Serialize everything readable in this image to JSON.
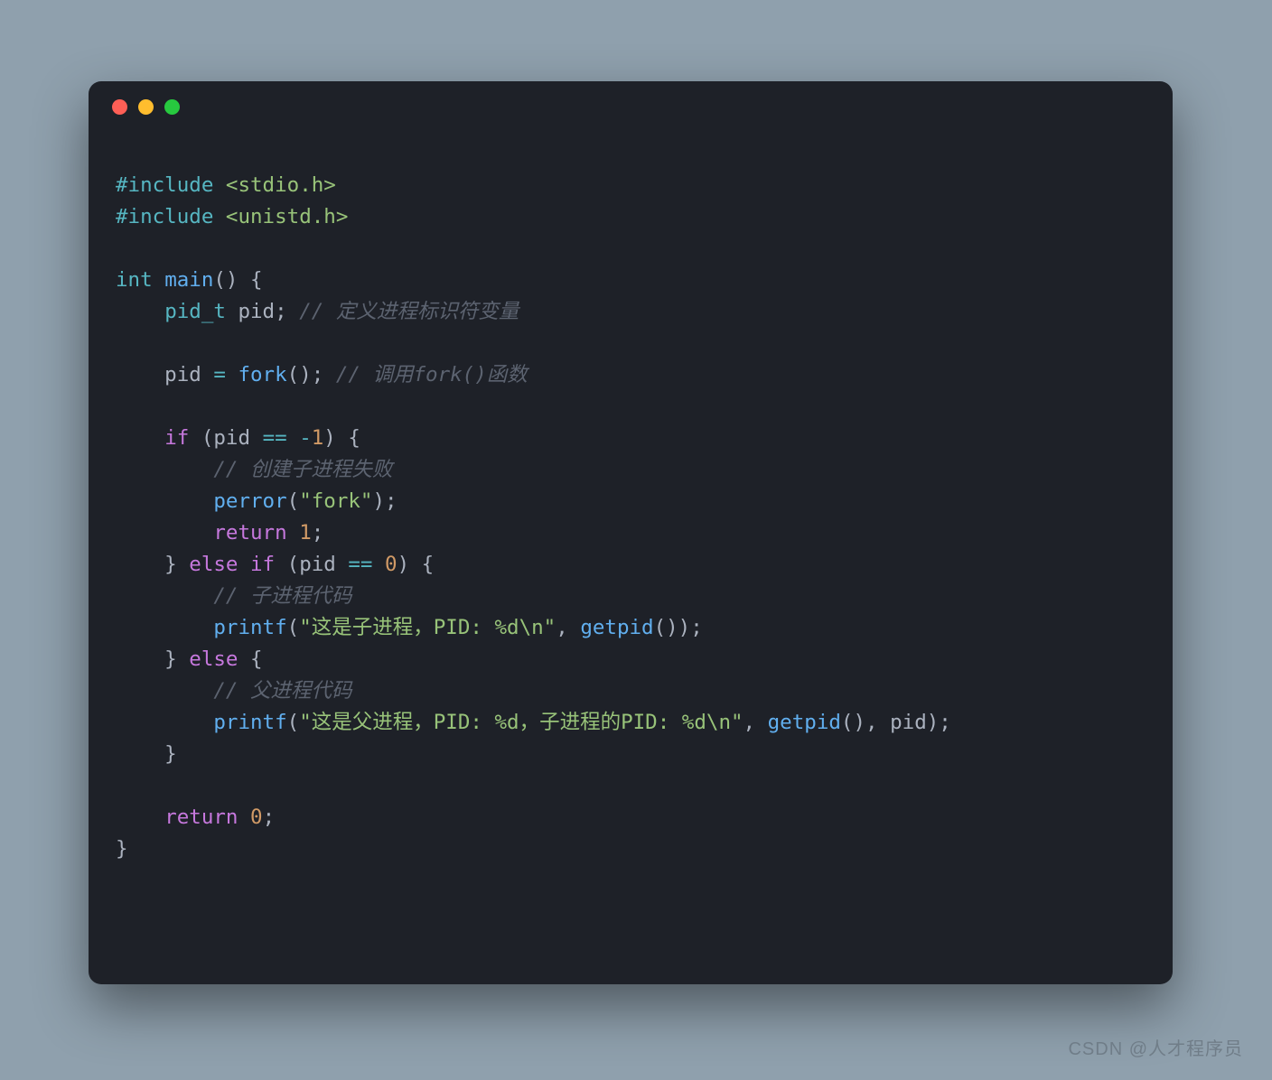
{
  "colors": {
    "background": "#8fa0ad",
    "window_bg": "#1e2128",
    "traffic_red": "#ff5f56",
    "traffic_yellow": "#ffbd2e",
    "traffic_green": "#27c93f"
  },
  "watermark": "CSDN @人才程序员",
  "code_lines": [
    [
      {
        "t": "#include",
        "c": "pre"
      },
      {
        "t": " ",
        "c": "punc"
      },
      {
        "t": "<stdio.h>",
        "c": "str"
      }
    ],
    [
      {
        "t": "#include",
        "c": "pre"
      },
      {
        "t": " ",
        "c": "punc"
      },
      {
        "t": "<unistd.h>",
        "c": "str"
      }
    ],
    [],
    [
      {
        "t": "int",
        "c": "type"
      },
      {
        "t": " ",
        "c": "punc"
      },
      {
        "t": "main",
        "c": "fn"
      },
      {
        "t": "() {",
        "c": "punc"
      }
    ],
    [
      {
        "t": "    ",
        "c": "punc"
      },
      {
        "t": "pid_t",
        "c": "type"
      },
      {
        "t": " pid; ",
        "c": "var"
      },
      {
        "t": "// 定义进程标识符变量",
        "c": "com"
      }
    ],
    [],
    [
      {
        "t": "    pid ",
        "c": "var"
      },
      {
        "t": "=",
        "c": "op"
      },
      {
        "t": " ",
        "c": "punc"
      },
      {
        "t": "fork",
        "c": "fn"
      },
      {
        "t": "(); ",
        "c": "punc"
      },
      {
        "t": "// 调用fork()函数",
        "c": "com"
      }
    ],
    [],
    [
      {
        "t": "    ",
        "c": "punc"
      },
      {
        "t": "if",
        "c": "key"
      },
      {
        "t": " (pid ",
        "c": "var"
      },
      {
        "t": "==",
        "c": "op"
      },
      {
        "t": " ",
        "c": "punc"
      },
      {
        "t": "-",
        "c": "op"
      },
      {
        "t": "1",
        "c": "num"
      },
      {
        "t": ") {",
        "c": "punc"
      }
    ],
    [
      {
        "t": "        ",
        "c": "punc"
      },
      {
        "t": "// 创建子进程失败",
        "c": "com"
      }
    ],
    [
      {
        "t": "        ",
        "c": "punc"
      },
      {
        "t": "perror",
        "c": "fn"
      },
      {
        "t": "(",
        "c": "punc"
      },
      {
        "t": "\"fork\"",
        "c": "str"
      },
      {
        "t": ");",
        "c": "punc"
      }
    ],
    [
      {
        "t": "        ",
        "c": "punc"
      },
      {
        "t": "return",
        "c": "key"
      },
      {
        "t": " ",
        "c": "punc"
      },
      {
        "t": "1",
        "c": "num"
      },
      {
        "t": ";",
        "c": "punc"
      }
    ],
    [
      {
        "t": "    } ",
        "c": "punc"
      },
      {
        "t": "else",
        "c": "key"
      },
      {
        "t": " ",
        "c": "punc"
      },
      {
        "t": "if",
        "c": "key"
      },
      {
        "t": " (pid ",
        "c": "var"
      },
      {
        "t": "==",
        "c": "op"
      },
      {
        "t": " ",
        "c": "punc"
      },
      {
        "t": "0",
        "c": "num"
      },
      {
        "t": ") {",
        "c": "punc"
      }
    ],
    [
      {
        "t": "        ",
        "c": "punc"
      },
      {
        "t": "// 子进程代码",
        "c": "com"
      }
    ],
    [
      {
        "t": "        ",
        "c": "punc"
      },
      {
        "t": "printf",
        "c": "fn"
      },
      {
        "t": "(",
        "c": "punc"
      },
      {
        "t": "\"这是子进程，PID: %d\\n\"",
        "c": "str"
      },
      {
        "t": ", ",
        "c": "punc"
      },
      {
        "t": "getpid",
        "c": "fn"
      },
      {
        "t": "());",
        "c": "punc"
      }
    ],
    [
      {
        "t": "    } ",
        "c": "punc"
      },
      {
        "t": "else",
        "c": "key"
      },
      {
        "t": " {",
        "c": "punc"
      }
    ],
    [
      {
        "t": "        ",
        "c": "punc"
      },
      {
        "t": "// 父进程代码",
        "c": "com"
      }
    ],
    [
      {
        "t": "        ",
        "c": "punc"
      },
      {
        "t": "printf",
        "c": "fn"
      },
      {
        "t": "(",
        "c": "punc"
      },
      {
        "t": "\"这是父进程，PID: %d，子进程的PID: %d\\n\"",
        "c": "str"
      },
      {
        "t": ", ",
        "c": "punc"
      },
      {
        "t": "getpid",
        "c": "fn"
      },
      {
        "t": "(), pid);",
        "c": "punc"
      }
    ],
    [
      {
        "t": "    }",
        "c": "punc"
      }
    ],
    [],
    [
      {
        "t": "    ",
        "c": "punc"
      },
      {
        "t": "return",
        "c": "key"
      },
      {
        "t": " ",
        "c": "punc"
      },
      {
        "t": "0",
        "c": "num"
      },
      {
        "t": ";",
        "c": "punc"
      }
    ],
    [
      {
        "t": "}",
        "c": "punc"
      }
    ]
  ]
}
